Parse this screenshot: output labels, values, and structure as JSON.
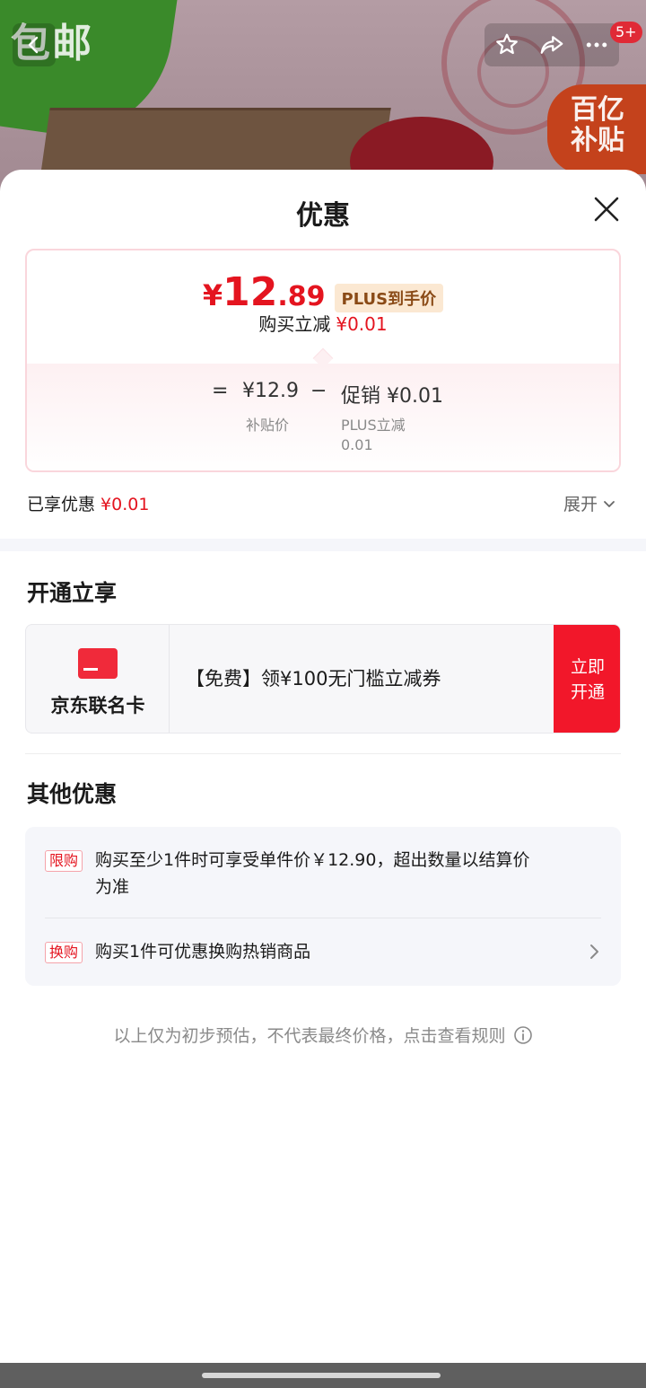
{
  "background": {
    "promo_left": "包邮",
    "subsidy_line1": "百亿",
    "subsidy_line2": "补贴",
    "cart_badge": "5+"
  },
  "sheet": {
    "title": "优惠"
  },
  "price_card": {
    "currency": "¥",
    "price_int": "12",
    "price_dec": ".89",
    "plus_tag": "PLUS到手价",
    "reduce_label": "购买立减",
    "reduce_value": "¥0.01",
    "eq": "=",
    "subsidy_price": "¥12.9",
    "subsidy_price_label": "补贴价",
    "minus": "−",
    "promo_label": "促销 ¥0.01",
    "promo_sub_line1": "PLUS立减",
    "promo_sub_line2": "0.01"
  },
  "enjoyed": {
    "label": "已享优惠",
    "value": "¥0.01",
    "expand_label": "展开"
  },
  "open_section": {
    "title": "开通立享",
    "card_name": "京东联名卡",
    "card_text": "【免费】领¥100无门槛立减券",
    "button_line1": "立即",
    "button_line2": "开通"
  },
  "other_section": {
    "title": "其他优惠",
    "items": [
      {
        "tag": "限购",
        "text_line1": "购买至少1件时可享受单件价￥12.90，超出数量以结算价",
        "text_line2": "为准"
      },
      {
        "tag": "换购",
        "text_line1": "购买1件可优惠换购热销商品"
      }
    ]
  },
  "footnote": "以上仅为初步预估，不代表最终价格，点击查看规则"
}
